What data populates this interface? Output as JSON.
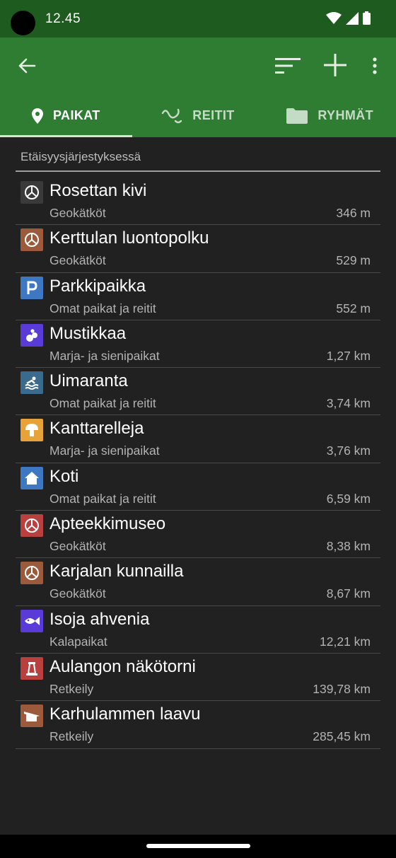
{
  "status_bar": {
    "time": "12.45"
  },
  "toolbar": {
    "back_icon": "arrow-left-icon",
    "sort_icon": "sort-icon",
    "add_icon": "plus-icon",
    "more_icon": "more-vertical-icon"
  },
  "tabs": [
    {
      "label": "PAIKAT",
      "icon": "location-pin-icon",
      "active": true
    },
    {
      "label": "REITIT",
      "icon": "route-icon",
      "active": false
    },
    {
      "label": "RYHMÄT",
      "icon": "folder-icon",
      "active": false
    }
  ],
  "list": {
    "header": "Etäisyysjärjestyksessä",
    "items": [
      {
        "title": "Rosettan kivi",
        "category": "Geokätköt",
        "distance": "346 m",
        "icon": "geocache-icon",
        "color": "#3a3a3a"
      },
      {
        "title": "Kerttulan luontopolku",
        "category": "Geokätköt",
        "distance": "529 m",
        "icon": "geocache-icon",
        "color": "#9b5a3c"
      },
      {
        "title": "Parkkipaikka",
        "category": "Omat paikat ja reitit",
        "distance": "552 m",
        "icon": "parking-icon",
        "color": "#3f78c2"
      },
      {
        "title": "Mustikkaa",
        "category": "Marja- ja sienipaikat",
        "distance": "1,27 km",
        "icon": "berry-icon",
        "color": "#5a3bd8"
      },
      {
        "title": "Uimaranta",
        "category": "Omat paikat ja reitit",
        "distance": "3,74 km",
        "icon": "swimming-icon",
        "color": "#3a6a8c"
      },
      {
        "title": "Kanttarelleja",
        "category": "Marja- ja sienipaikat",
        "distance": "3,76 km",
        "icon": "mushroom-icon",
        "color": "#e7a33a"
      },
      {
        "title": "Koti",
        "category": "Omat paikat ja reitit",
        "distance": "6,59 km",
        "icon": "home-icon",
        "color": "#3f78c2"
      },
      {
        "title": "Apteekkimuseo",
        "category": "Geokätköt",
        "distance": "8,38 km",
        "icon": "geocache-icon",
        "color": "#b8413f"
      },
      {
        "title": "Karjalan kunnailla",
        "category": "Geokätköt",
        "distance": "8,67 km",
        "icon": "geocache-icon",
        "color": "#9b5a3c"
      },
      {
        "title": "Isoja ahvenia",
        "category": "Kalapaikat",
        "distance": "12,21 km",
        "icon": "fish-icon",
        "color": "#5a3bd8"
      },
      {
        "title": "Aulangon näkötorni",
        "category": "Retkeily",
        "distance": "139,78 km",
        "icon": "tower-icon",
        "color": "#b8413f"
      },
      {
        "title": "Karhulammen laavu",
        "category": "Retkeily",
        "distance": "285,45 km",
        "icon": "shelter-icon",
        "color": "#9b5a3c"
      }
    ]
  }
}
